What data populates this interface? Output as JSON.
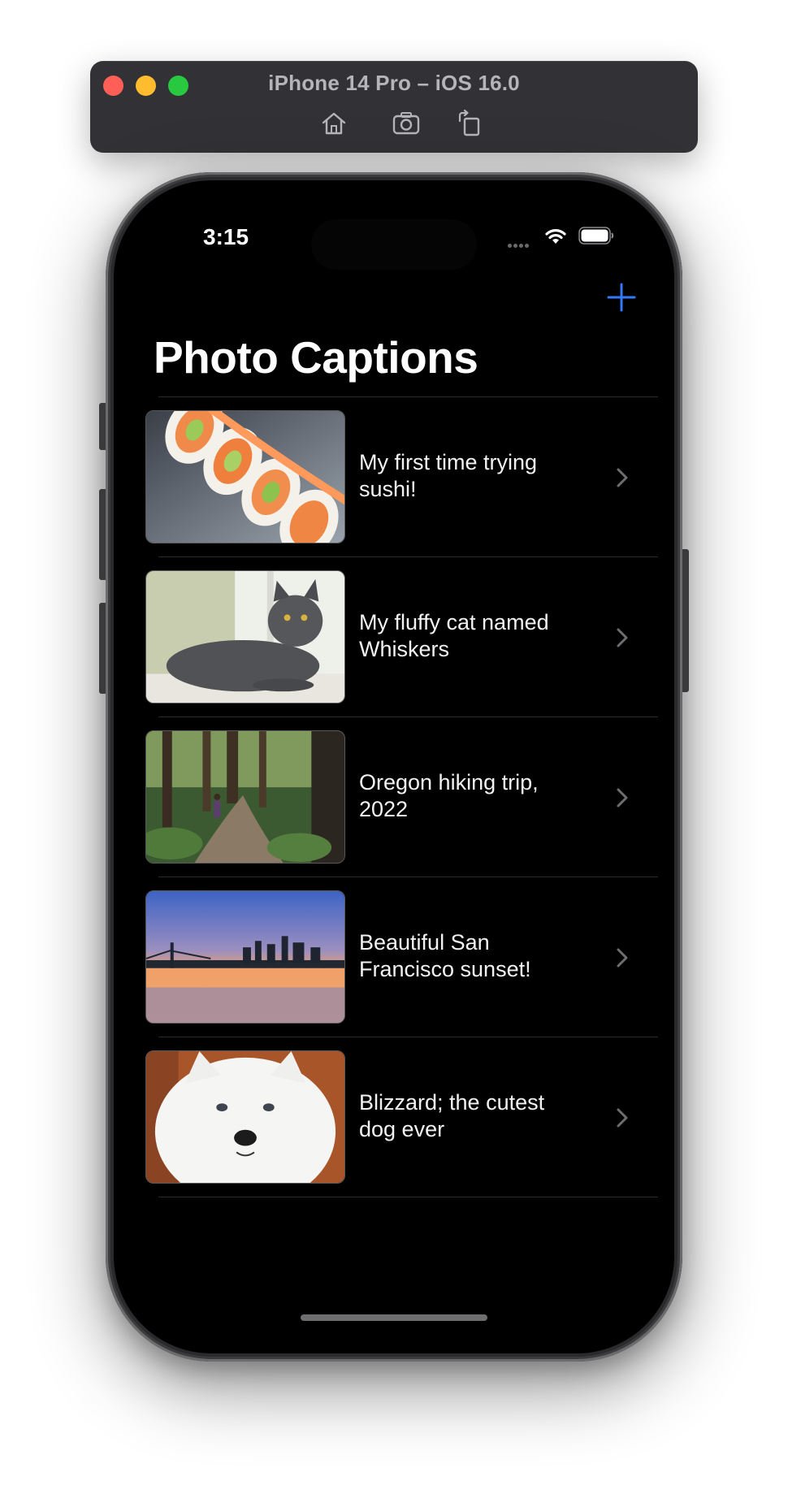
{
  "simulator": {
    "title": "iPhone 14 Pro – iOS 16.0",
    "toolbar": [
      "home-icon",
      "screenshot-icon",
      "rotate-icon"
    ]
  },
  "status_bar": {
    "time": "3:15",
    "icons": [
      "signal-icon",
      "wifi-icon",
      "battery-icon"
    ]
  },
  "nav": {
    "title": "Photo Captions",
    "add_icon": "plus-icon",
    "accent_color": "#3478f6"
  },
  "items": [
    {
      "image": "sushi-photo",
      "caption": "My first time trying sushi!"
    },
    {
      "image": "cat-photo",
      "caption": "My fluffy cat named Whiskers"
    },
    {
      "image": "forest-trail-photo",
      "caption": "Oregon hiking trip, 2022"
    },
    {
      "image": "sunset-bridge-photo",
      "caption": "Beautiful San Francisco sunset!"
    },
    {
      "image": "white-dog-photo",
      "caption": "Blizzard; the cutest dog ever"
    }
  ]
}
